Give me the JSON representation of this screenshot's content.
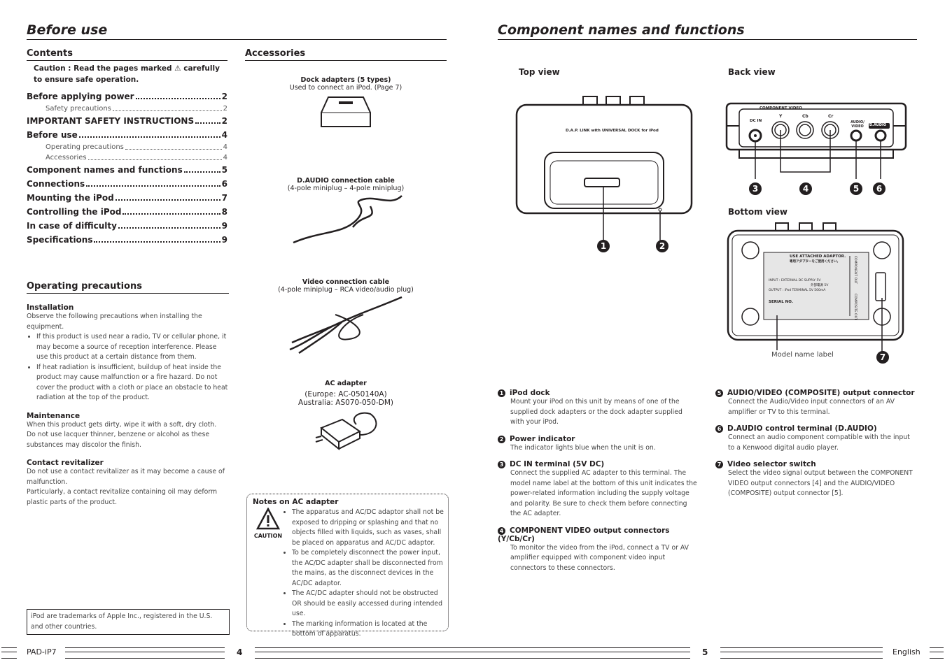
{
  "left": {
    "title": "Before use",
    "contents": {
      "heading": "Contents",
      "caution": "Caution : Read the pages marked ⚠ carefully to ensure safe operation.",
      "entries": [
        {
          "label": "Before applying power",
          "page": "2",
          "level": 1
        },
        {
          "label": "Safety precautions",
          "page": "2",
          "level": 2
        },
        {
          "label": "IMPORTANT SAFETY INSTRUCTIONS",
          "page": "2",
          "level": 1
        },
        {
          "label": "Before use",
          "page": "4",
          "level": 1
        },
        {
          "label": "Operating precautions",
          "page": "4",
          "level": 2
        },
        {
          "label": "Accessories",
          "page": "4",
          "level": 2
        },
        {
          "label": "Component names and functions",
          "page": "5",
          "level": 1
        },
        {
          "label": "Connections",
          "page": "6",
          "level": 1
        },
        {
          "label": "Mounting the iPod",
          "page": "7",
          "level": 1
        },
        {
          "label": "Controlling the iPod",
          "page": "8",
          "level": 1
        },
        {
          "label": "In case of difficulty",
          "page": "9",
          "level": 1
        },
        {
          "label": "Specifications",
          "page": "9",
          "level": 1
        }
      ]
    },
    "precautions": {
      "heading": "Operating precautions",
      "installation": {
        "title": "Installation",
        "intro": "Observe the following precautions when installing the equipment.",
        "bullets": [
          "If this product is used near a radio, TV or cellular phone, it may become a source of reception interference. Please use this product at a certain distance from them.",
          "If heat radiation is insufficient, buildup of heat inside the product may cause malfunction or a fire hazard. Do not cover the product with a cloth or place an obstacle to heat radiation at the top of the product."
        ]
      },
      "maintenance": {
        "title": "Maintenance",
        "text1": "When this product gets dirty, wipe it with a soft, dry cloth.",
        "text2": "Do not use lacquer thinner, benzene or alcohol as these substances may discolor the finish."
      },
      "revitalizer": {
        "title": "Contact revitalizer",
        "text1": "Do not use a contact revitalizer as it may become a cause of malfunction.",
        "text2": "Particularly, a contact revitalize containing oil may deform plastic parts of the product."
      }
    },
    "trademark": "iPod are trademarks of Apple Inc., registered in the U.S. and other countries.",
    "accessories": {
      "heading": "Accessories",
      "items": [
        {
          "name": "Dock adapters (5 types)",
          "desc": "Used to connect an iPod. (Page 7)"
        },
        {
          "name": "D.AUDIO connection cable",
          "desc": "(4-pole miniplug – 4-pole miniplug)"
        },
        {
          "name": "Video connection cable",
          "desc": "(4-pole miniplug – RCA video/audio plug)"
        },
        {
          "name": "AC adapter",
          "desc": "(Europe: AC-050140A)",
          "desc2": "Australia: AS070-050-DM)"
        }
      ]
    },
    "notes": {
      "title": "Notes on AC adapter",
      "caution_label": "CAUTION",
      "bullets": [
        "The apparatus and AC/DC adaptor shall not be exposed to dripping or splashing and that no objects filled with liquids, such as vases, shall be placed on apparatus and AC/DC adaptor.",
        "To be completely disconnect the power input, the AC/DC adapter shall be disconnected from the mains, as the disconnect devices in the AC/DC adaptor.",
        "The AC/DC adapter should not be obstructed OR should be easily accessed during intended use.",
        "The marking information is located at the bottom of apparatus."
      ]
    }
  },
  "right": {
    "title": "Component names and functions",
    "top_view": "Top view",
    "back_view": "Back view",
    "bottom_view": "Bottom view",
    "device_label": "D.A.P. LINK with UNIVERSAL DOCK for iPod",
    "back_labels": {
      "component": "COMPONENT VIDEO",
      "dcin": "DC IN",
      "y": "Y",
      "cb": "Cb",
      "cr": "Cr",
      "av": "AUDIO/ VIDEO",
      "daudio": "D.AUDIO"
    },
    "bottom_labels": {
      "adaptor": "USE ATTACHED ADAPTOR.",
      "jp": "専用アダプターをご使用ください。",
      "input": "INPUT : EXTERNAL DC SUPPLY 5V",
      "jp2": "外部電源 5V",
      "output": "OUTPUT : iPod TERMINAL 5V 500mA",
      "serial": "SERIAL NO.",
      "component_out": "COMPONENT OUT",
      "composite_out": "COMPOSITE OUT"
    },
    "model_label": "Model name label",
    "items": [
      {
        "n": "1",
        "title": "iPod dock",
        "text": "Mount your iPod on this unit by means of one of the supplied dock adapters or the dock adapter supplied with your iPod."
      },
      {
        "n": "2",
        "title": "Power indicator",
        "text": "The indicator lights blue when the unit is on."
      },
      {
        "n": "3",
        "title": "DC IN terminal (5V DC)",
        "text": "Connect the supplied AC adapter to this terminal. The model name label at the bottom of this unit indicates the power-related information including the supply voltage and polarity. Be sure to check them before connecting the AC adapter."
      },
      {
        "n": "4",
        "title": "COMPONENT VIDEO output connectors (Y/Cb/Cr)",
        "text": "To monitor the video from the iPod, connect a TV or AV amplifier equipped with component video input connectors to these connectors."
      },
      {
        "n": "5",
        "title": "AUDIO/VIDEO (COMPOSITE) output connector",
        "text": "Connect the Audio/Video input connectors of an AV amplifier or TV to this terminal."
      },
      {
        "n": "6",
        "title": "D.AUDIO control terminal (D.AUDIO)",
        "text": "Connect an audio component compatible with the input to a Kenwood digital audio player."
      },
      {
        "n": "7",
        "title": "Video selector switch",
        "text": "Select the video signal output between the COMPONENT VIDEO output connectors [4] and the AUDIO/VIDEO (COMPOSITE) output connector [5]."
      }
    ]
  },
  "footer": {
    "model": "PAD-iP7",
    "page_left": "4",
    "page_right": "5",
    "language": "English"
  }
}
